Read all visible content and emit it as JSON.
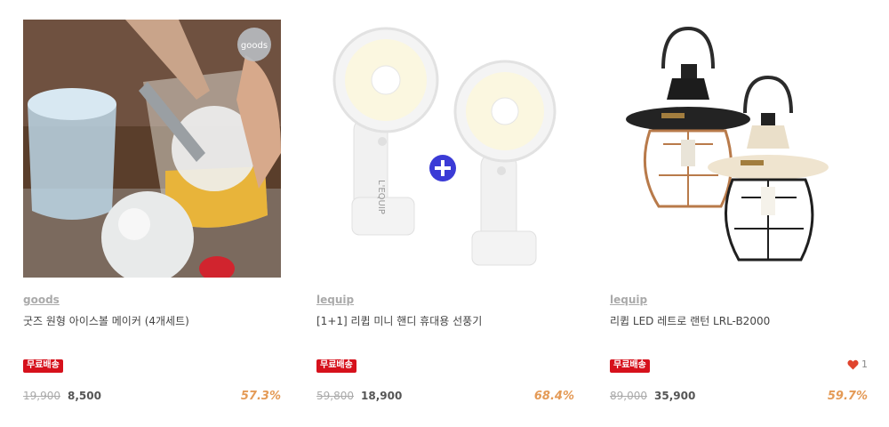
{
  "products": [
    {
      "brand": "goods",
      "name": "굿즈 원형 아이스볼 메이커 (4개세트)",
      "badge": "무료배송",
      "original_price": "19,900",
      "sale_price": "8,500",
      "discount": "57.3%",
      "image_logo_text": "goods",
      "likes": null
    },
    {
      "brand": "lequip",
      "name": "[1+1] 리큅 미니 핸디 휴대용 선풍기",
      "badge": "무료배송",
      "original_price": "59,800",
      "sale_price": "18,900",
      "discount": "68.4%",
      "image_logo_text": "L'EQUIP",
      "likes": null
    },
    {
      "brand": "lequip",
      "name": "리큅 LED 레트로 랜턴 LRL-B2000",
      "badge": "무료배송",
      "original_price": "89,000",
      "sale_price": "35,900",
      "discount": "59.7%",
      "likes": "1"
    }
  ],
  "colors": {
    "badge": "#d6111c",
    "discount": "#e49a56",
    "heart": "#e0442e"
  }
}
